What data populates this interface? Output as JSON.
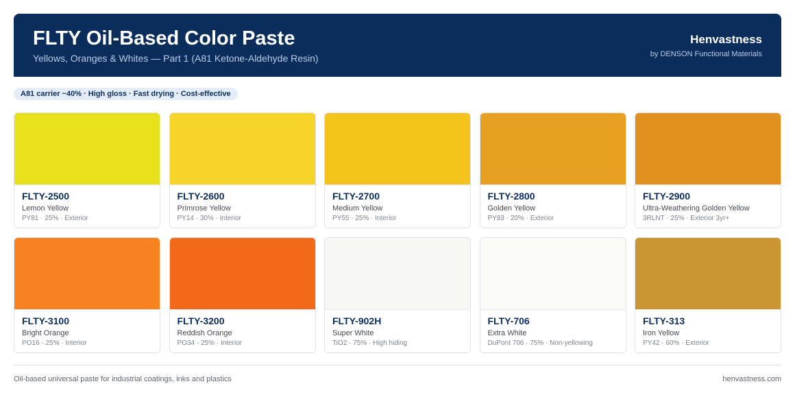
{
  "header": {
    "title": "FLTY Oil-Based Color Paste",
    "subtitle": "Yellows, Oranges & Whites — Part 1 (A81 Ketone-Aldehyde Resin)",
    "brand": "Henvastness",
    "brand_sub": "by DENSON Functional Materials"
  },
  "tag": "A81 carrier ~40% · High gloss · Fast drying · Cost-effective",
  "products": [
    {
      "code": "FLTY-2500",
      "name": "Lemon Yellow",
      "spec": "PY81 · 25% · Exterior",
      "color": "#e6e11a"
    },
    {
      "code": "FLTY-2600",
      "name": "Primrose Yellow",
      "spec": "PY14 · 30% · Interior",
      "color": "#f6d42a"
    },
    {
      "code": "FLTY-2700",
      "name": "Medium Yellow",
      "spec": "PY55 · 25% · Interior",
      "color": "#f4c41c"
    },
    {
      "code": "FLTY-2800",
      "name": "Golden Yellow",
      "spec": "PY83 · 20% · Exterior",
      "color": "#e6a022"
    },
    {
      "code": "FLTY-2900",
      "name": "Ultra-Weathering Golden Yellow",
      "spec": "3RLNT · 25% · Exterior 3yr+",
      "color": "#e0901c"
    },
    {
      "code": "FLTY-3100",
      "name": "Bright Orange",
      "spec": "PO16 · 25% · Interior",
      "color": "#f5821f"
    },
    {
      "code": "FLTY-3200",
      "name": "Reddish Orange",
      "spec": "PO34 · 25% · Interior",
      "color": "#f06a1a"
    },
    {
      "code": "FLTY-902H",
      "name": "Super White",
      "spec": "TiO2 · 75% · High hiding",
      "color": "#f7f8f4"
    },
    {
      "code": "FLTY-706",
      "name": "Extra White",
      "spec": "DuPont 706 · 75% · Non-yellowing",
      "color": "#fafaf7"
    },
    {
      "code": "FLTY-313",
      "name": "Iron Yellow",
      "spec": "PY42 · 60% · Exterior",
      "color": "#c99631"
    }
  ],
  "footer": {
    "left": "Oil-based universal paste for industrial coatings, inks and plastics",
    "right": "henvastness.com"
  }
}
